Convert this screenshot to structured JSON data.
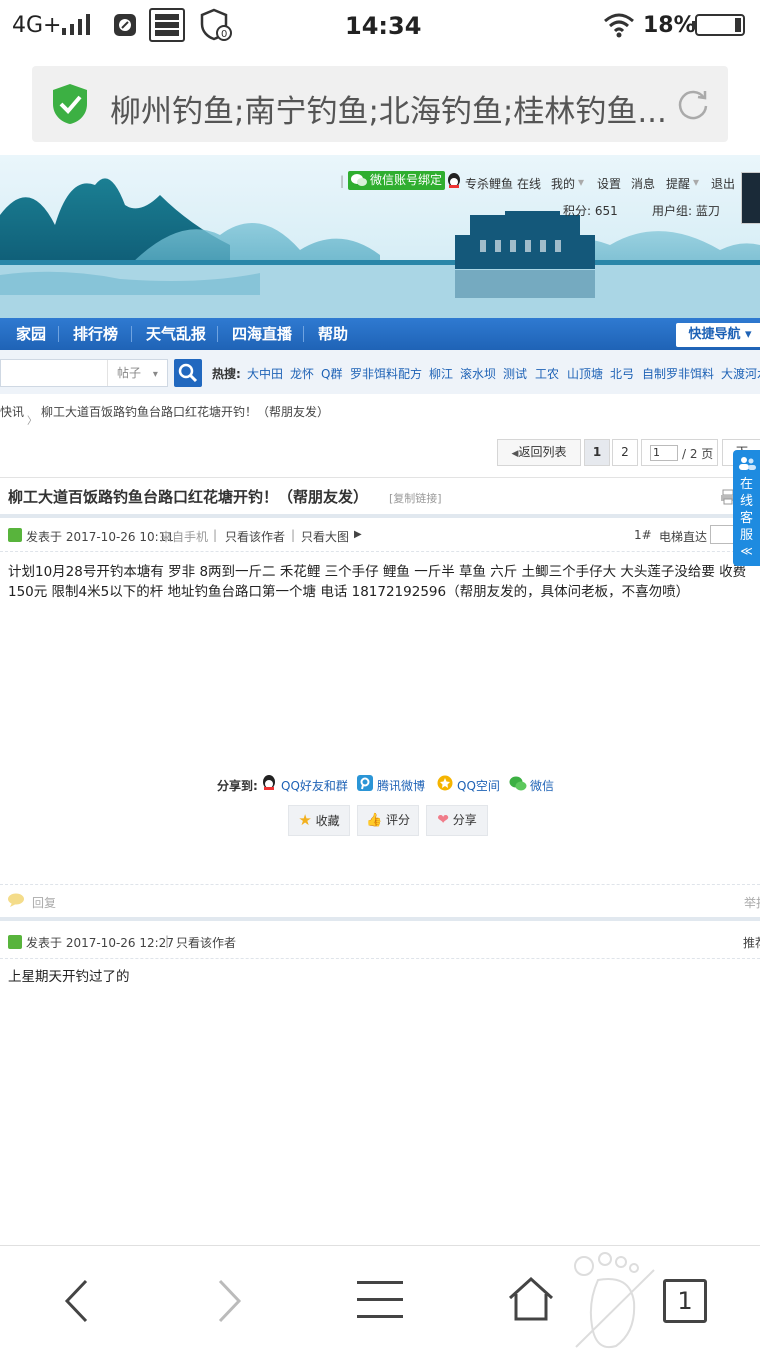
{
  "status_bar": {
    "network": "4G+",
    "time": "14:34",
    "battery": "18%"
  },
  "browser": {
    "page_title": "柳州钓鱼;南宁钓鱼;北海钓鱼;桂林钓鱼...",
    "tab_count": "1"
  },
  "header": {
    "wechat_bind": "微信账号绑定",
    "username": "专杀鲤鱼",
    "online": "在线",
    "my": "我的",
    "settings": "设置",
    "messages": "消息",
    "alerts": "提醒",
    "logout": "退出",
    "points": "积分: 651",
    "user_group": "用户组: 蓝刀"
  },
  "nav": {
    "items": [
      "家园",
      "排行榜",
      "天气乱报",
      "四海直播",
      "帮助"
    ],
    "quick_nav": "快捷导航"
  },
  "search": {
    "type": "帖子",
    "hot_label": "热搜:",
    "hot_items": [
      "大中田",
      "龙怀",
      "Q群",
      "罗非饵料配方",
      "柳江",
      "滚水坝",
      "测试",
      "工农",
      "山顶塘",
      "北弓",
      "自制罗非饵料",
      "大渡河水"
    ]
  },
  "breadcrumb": {
    "parent": "快讯",
    "current": "柳工大道百饭路钓鱼台路口红花塘开钓！（帮朋友发）"
  },
  "pager": {
    "back": "返回列表",
    "page1": "1",
    "page2": "2",
    "input": "1",
    "total": "/ 2 页",
    "next": "下"
  },
  "thread": {
    "title": "柳工大道百饭路钓鱼台路口红花塘开钓！（帮朋友发）",
    "copy_link": "[复制链接]"
  },
  "post1": {
    "meta": "发表于 2017-10-26 10:11",
    "source": "来自手机",
    "only_author": "只看该作者",
    "only_big_img": "只看大图",
    "floor": "1#",
    "elevator": "电梯直达",
    "content": "计划10月28号开钓本塘有 罗非  8两到一斤二  禾花鲤    三个手仔   鲤鱼 一斤半    草鱼  六斤   土鲫三个手仔大   大头莲子没给要   收费150元     限制4米5以下的杆    地址钓鱼台路口第一个塘  电话 18172192596（帮朋友发的，具体问老板，不喜勿喷）",
    "share_label": "分享到:",
    "share": [
      "QQ好友和群",
      "腾讯微博",
      "QQ空间",
      "微信"
    ],
    "actions": [
      "收藏",
      "评分",
      "分享"
    ],
    "reply": "回复",
    "report": "举报"
  },
  "post2": {
    "meta": "发表于 2017-10-26 12:27",
    "only_author": "只看该作者",
    "recommend": "推荐",
    "content": "上星期天开钓过了的"
  },
  "kefu": {
    "label": "在线客服"
  },
  "colors": {
    "nav_blue": "#1f63b6",
    "link_blue": "#1f63b6",
    "shield_green": "#3cb043"
  }
}
